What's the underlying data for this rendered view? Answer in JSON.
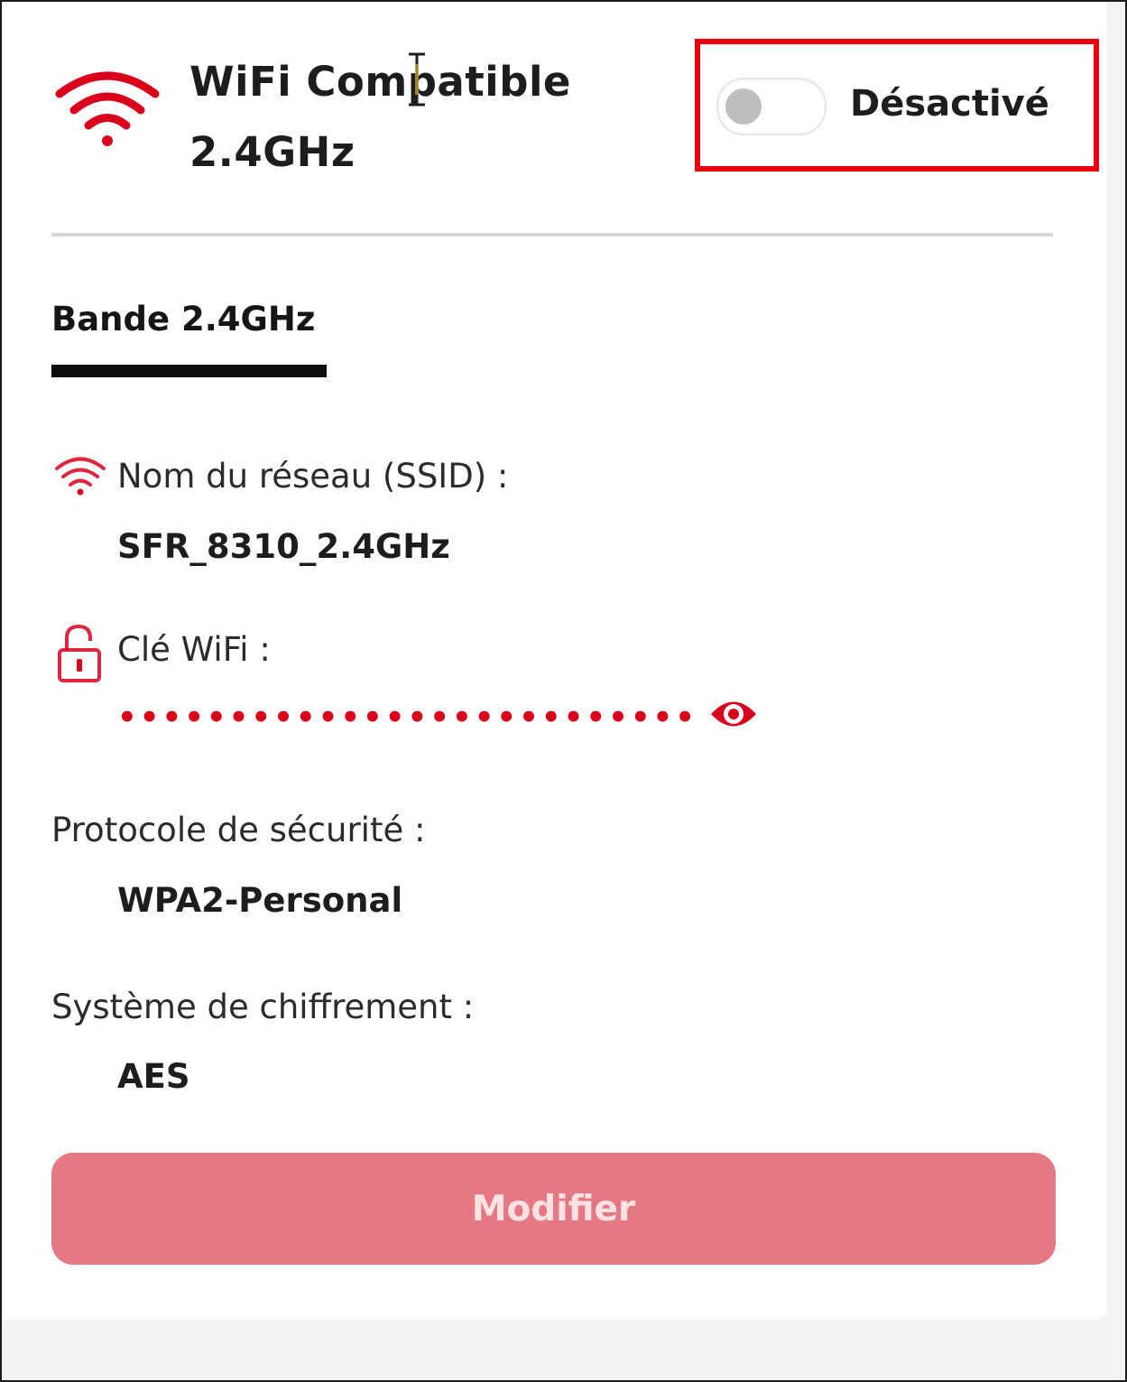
{
  "header": {
    "title_line1": "WiFi Compatible",
    "title_line2": "2.4GHz",
    "toggle_state": "Désactivé",
    "toggle_on": false
  },
  "tab": {
    "label": "Bande 2.4GHz"
  },
  "fields": {
    "ssid_label": "Nom du réseau (SSID) :",
    "ssid_value": "SFR_8310_2.4GHz",
    "key_label": "Clé WiFi :",
    "key_value": "••••••••••••••••••••••••••••",
    "protocol_label": "Protocole de sécurité :",
    "protocol_value": "WPA2-Personal",
    "encryption_label": "Système de chiffrement :",
    "encryption_value": "AES"
  },
  "actions": {
    "modify_label": "Modifier"
  },
  "icons": {
    "header": "wifi-icon",
    "ssid": "wifi-icon",
    "key": "unlock-icon",
    "reveal": "eye-icon"
  },
  "colors": {
    "accent": "#d9001b",
    "button": "#e57983",
    "button_text": "#fbe3e5",
    "highlight": "#e8000d"
  }
}
